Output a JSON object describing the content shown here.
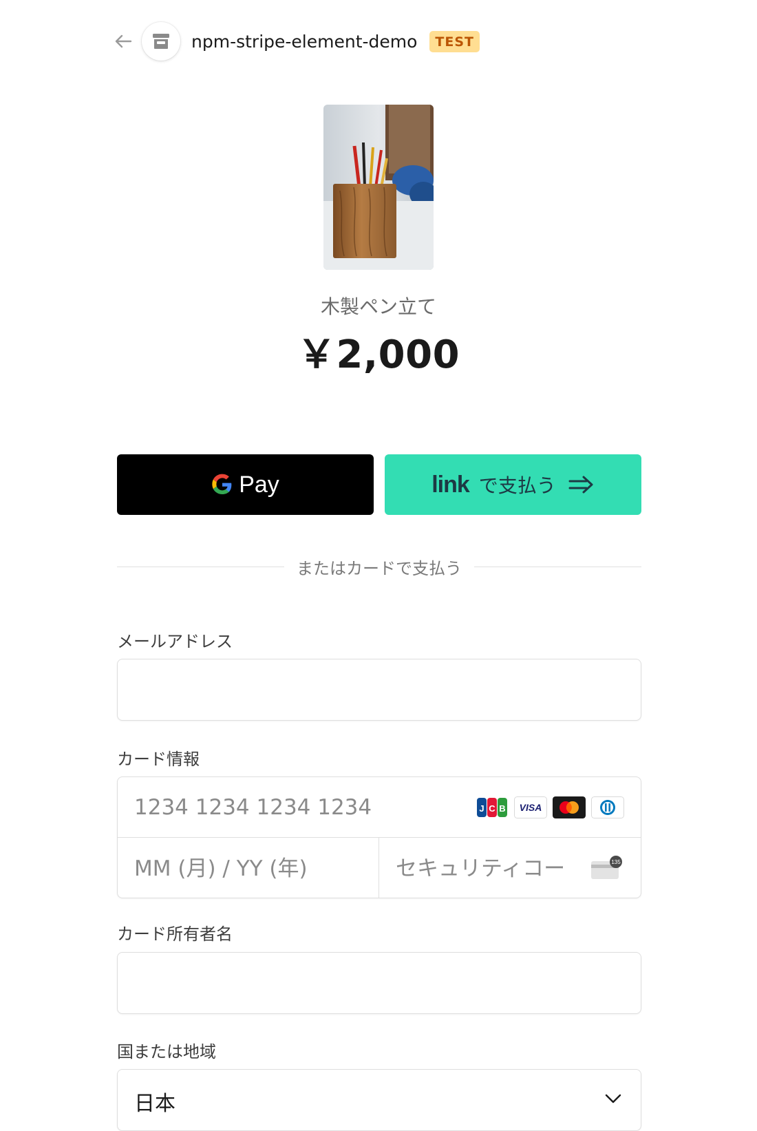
{
  "header": {
    "merchant_name": "npm-stripe-element-demo",
    "badge": "TEST",
    "badge_bg": "#ffde92",
    "badge_color": "#bb5504",
    "back_icon": "arrow-left-icon",
    "store_icon": "storefront-icon"
  },
  "product": {
    "image_label": "wooden pen holder photo",
    "name": "木製ペン立て",
    "price": "￥2,000"
  },
  "express": {
    "gpay_label": "Pay",
    "gpay_bg": "#000000",
    "link_logo": "link",
    "link_text": "で支払う",
    "link_bg": "#33ddb3"
  },
  "divider": {
    "text": "またはカードで支払う"
  },
  "form": {
    "email_label": "メールアドレス",
    "email_value": "",
    "card_label": "カード情報",
    "card_number_placeholder": "1234 1234 1234 1234",
    "card_brands": [
      "jcb",
      "visa",
      "mastercard",
      "diners"
    ],
    "expiry_placeholder": "MM (月) / YY (年)",
    "cvc_placeholder": "セキュリティコード",
    "cvc_icon_text": "135",
    "holder_label": "カード所有者名",
    "holder_value": "",
    "country_label": "国または地域",
    "country_value": "日本"
  }
}
